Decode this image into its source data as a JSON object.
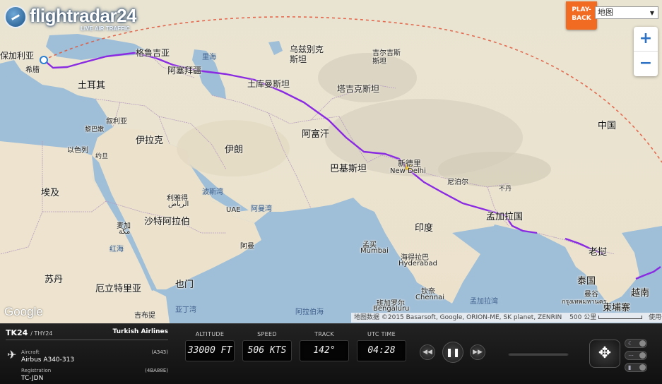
{
  "app": {
    "brand": "flightradar24",
    "tagline": "LIVE AIR TRAFFIC",
    "playback_label_1": "PLAY-",
    "playback_label_2": "BACK"
  },
  "map": {
    "map_type_selected": "地图",
    "zoom_in": "+",
    "zoom_out": "−",
    "google": "Google",
    "attribution": "地图数据 ©2015 Basarsoft, Google, ORION-ME, SK planet, ZENRIN",
    "scale_label": "500 公里",
    "terms": "使用条款",
    "labels": {
      "bulgaria": "保加利亚",
      "greece": "希腊",
      "turkey": "土耳其",
      "georgia": "格鲁吉亚",
      "azerbaijan": "阿塞拜疆",
      "caspian": "里海",
      "uzbekistan": "乌兹别克\n斯坦",
      "kyrgyzstan": "吉尔吉斯\n斯坦",
      "turkmenistan": "土库曼斯坦",
      "tajikistan": "塔吉克斯坦",
      "syria": "叙利亚",
      "lebanon": "黎巴嫩",
      "israel": "以色列",
      "jordan": "约旦",
      "iraq": "伊拉克",
      "iran": "伊朗",
      "afghanistan": "阿富汗",
      "pakistan": "巴基斯坦",
      "newdelhi_cn": "新德里",
      "newdelhi_en": "New Delhi",
      "nepal": "尼泊尔",
      "bhutan": "不丹",
      "china": "中国",
      "egypt": "埃及",
      "riyadh_cn": "利雅得",
      "riyadh_ar": "الرياض",
      "saudi": "沙特阿拉伯",
      "gulf": "波斯湾",
      "uae": "UAE",
      "oman_gulf": "阿曼湾",
      "oman": "阿曼",
      "mecca_cn": "麦加",
      "mecca_ar": "مكة",
      "red_sea": "红海",
      "india": "印度",
      "bangladesh": "孟加拉国",
      "mumbai_cn": "孟买",
      "mumbai_en": "Mumbai",
      "hyderabad_cn": "海得拉巴",
      "hyderabad_en": "Hyderabad",
      "chennai_cn": "钦奈",
      "chennai_en": "Chennai",
      "bengaluru_cn": "班加罗尔",
      "bengaluru_en": "Bengaluru",
      "bay_bengal": "孟加拉湾",
      "arabian_sea": "阿拉伯海",
      "sudan": "苏丹",
      "eritrea": "厄立特里亚",
      "yemen": "也门",
      "gulf_aden": "亚丁湾",
      "djibouti": "吉布提",
      "laos": "老挝",
      "thailand": "泰国",
      "bangkok_cn": "曼谷",
      "bangkok_th": "กรุงเทพมหานคร",
      "cambodia": "柬埔寨",
      "vietnam": "越南"
    }
  },
  "flight": {
    "number": "TK24",
    "callsign": "/ THY24",
    "airline": "Turkish Airlines",
    "aircraft_label": "Aircraft",
    "aircraft_code": "(A343)",
    "aircraft_type": "Airbus A340-313",
    "registration_label": "Registration",
    "registration_code": "(4BA88E)",
    "registration": "TC-JDN"
  },
  "gauges": {
    "altitude_label": "ALTITUDE",
    "altitude_value": "33000 FT",
    "speed_label": "SPEED",
    "speed_value": "506 KTS",
    "track_label": "TRACK",
    "track_value": "142°",
    "utc_label": "UTC TIME",
    "utc_value": "04:28"
  },
  "colors": {
    "route": "#8a2be2",
    "great_circle": "#e0553a",
    "playback": "#f26b22"
  }
}
